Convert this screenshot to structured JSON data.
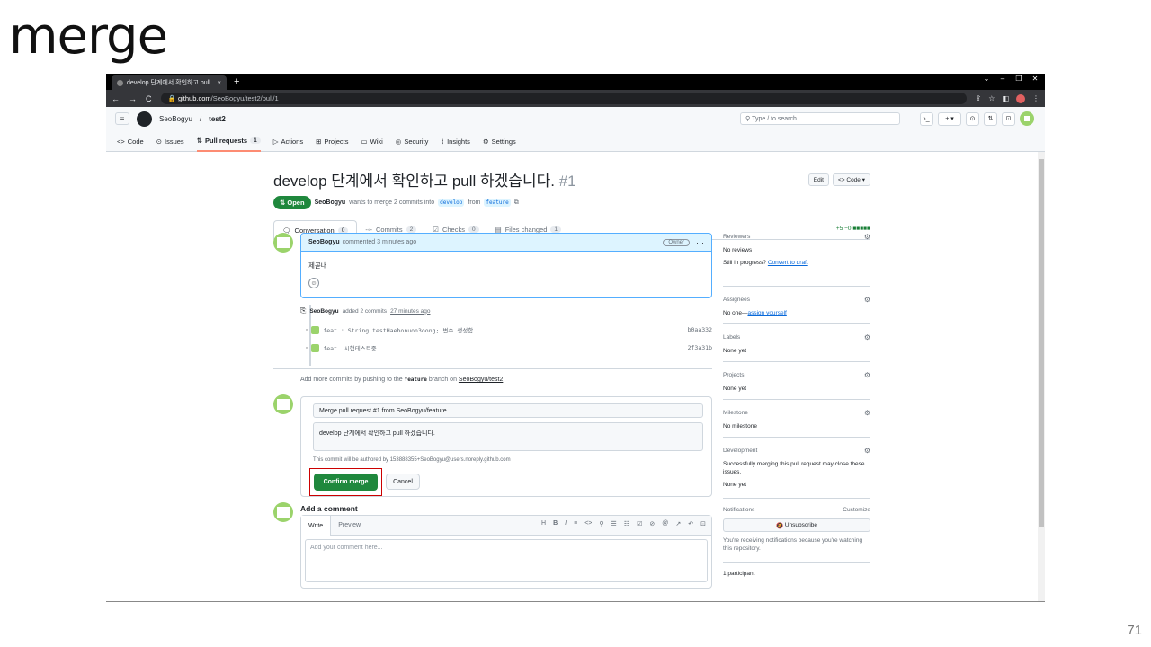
{
  "slide": {
    "title": "merge",
    "page_number": "71"
  },
  "browser": {
    "tab_title": "develop 단계에서 확인하고 pull",
    "tab_close": "×",
    "new_tab": "+",
    "url_host": "github.com",
    "url_path": "/SeoBogyu/test2/pull/1",
    "window_controls": [
      "⌄",
      "–",
      "❐",
      "✕"
    ]
  },
  "gh_header": {
    "owner": "SeoBogyu",
    "separator": "/",
    "repo": "test2",
    "search_placeholder": "Type / to search",
    "nav": [
      {
        "label": "Code",
        "icon": "<>"
      },
      {
        "label": "Issues",
        "icon": "⊙"
      },
      {
        "label": "Pull requests",
        "icon": "⇅",
        "count": "1"
      },
      {
        "label": "Actions",
        "icon": "▷"
      },
      {
        "label": "Projects",
        "icon": "⊞"
      },
      {
        "label": "Wiki",
        "icon": "▭"
      },
      {
        "label": "Security",
        "icon": "◎"
      },
      {
        "label": "Insights",
        "icon": "⌇"
      },
      {
        "label": "Settings",
        "icon": "⚙"
      }
    ]
  },
  "pr": {
    "title": "develop 단계에서 확인하고 pull 하겠습니다.",
    "number": "#1",
    "edit_label": "Edit",
    "code_label": "<> Code ▾",
    "state": "Open",
    "author": "SeoBogyu",
    "meta_text": "wants to merge 2 commits into",
    "base_branch": "develop",
    "from_text": "from",
    "head_branch": "feature",
    "tabs": [
      {
        "label": "Conversation",
        "count": "0"
      },
      {
        "label": "Commits",
        "count": "2"
      },
      {
        "label": "Checks",
        "count": "0"
      },
      {
        "label": "Files changed",
        "count": "1"
      }
    ],
    "diffstat": "+5 −0 ■■■■■"
  },
  "comment": {
    "author": "SeoBogyu",
    "time_text": "commented 3 minutes ago",
    "badge": "Owner",
    "menu": "···",
    "body": "제곧내",
    "emoji": "☺"
  },
  "timeline": {
    "author": "SeoBogyu",
    "added_text": "added 2 commits",
    "added_time": "27 minutes ago",
    "commits": [
      {
        "message": "feat : String testHaebonuon3oong; 변수 생성함",
        "sha": "b0aa332"
      },
      {
        "message": "feat. 시험테스트중",
        "sha": "2f3a31b"
      }
    ]
  },
  "push_note": {
    "prefix": "Add more commits by pushing to the",
    "branch": "feature",
    "middle": "branch on",
    "repo": "SeoBogyu/test2",
    "suffix": "."
  },
  "merge": {
    "title_value": "Merge pull request #1 from SeoBogyu/feature",
    "body_value": "develop 단계에서 확인하고 pull 하겠습니다.",
    "note": "This commit will be authored by 153888355+SeoBogyu@users.noreply.github.com",
    "confirm_label": "Confirm merge",
    "cancel_label": "Cancel"
  },
  "add_comment": {
    "label": "Add a comment",
    "tab_write": "Write",
    "tab_preview": "Preview",
    "toolbar": [
      "H",
      "B",
      "I",
      "≡",
      "<>",
      "⚲",
      "☰",
      "☷",
      "☑",
      "⊘",
      "@",
      "↗",
      "↶",
      "⊡"
    ],
    "placeholder": "Add your comment here..."
  },
  "sidebar": {
    "reviewers": {
      "label": "Reviewers",
      "line1": "No reviews",
      "line2_prefix": "Still in progress?",
      "line2_link": "Convert to draft"
    },
    "assignees": {
      "label": "Assignees",
      "prefix": "No one—",
      "link": "assign yourself"
    },
    "labels": {
      "label": "Labels",
      "value": "None yet"
    },
    "projects": {
      "label": "Projects",
      "value": "None yet"
    },
    "milestone": {
      "label": "Milestone",
      "value": "No milestone"
    },
    "development": {
      "label": "Development",
      "text": "Successfully merging this pull request may close these issues.",
      "value": "None yet"
    },
    "notifications": {
      "label": "Notifications",
      "customize": "Customize",
      "button": "Unsubscribe",
      "text": "You're receiving notifications because you're watching this repository."
    },
    "participants": "1 participant",
    "gear": "⚙"
  }
}
